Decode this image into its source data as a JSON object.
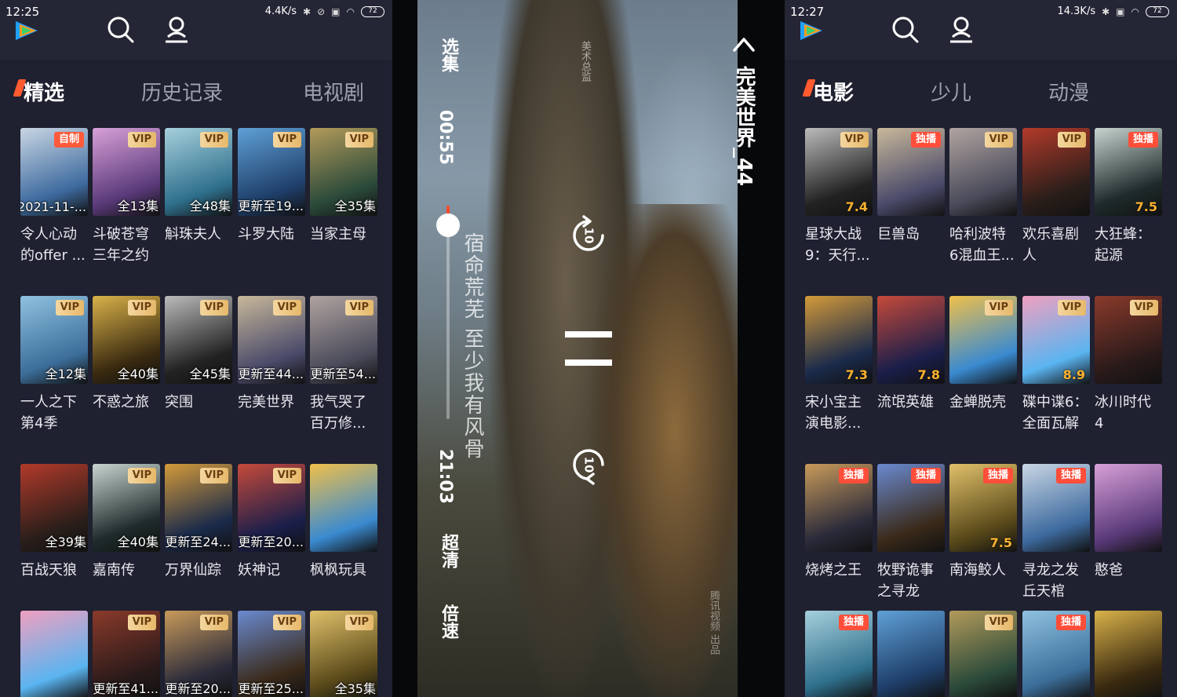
{
  "left": {
    "time": "12:25",
    "speed": "4.4K/s",
    "battery": "72",
    "tabs": [
      "精选",
      "历史记录",
      "电视剧"
    ],
    "cards": [
      {
        "title": "令人心动\n的offer ...",
        "badge": "自制",
        "badge_type": "zizhi",
        "ep": "2021-11-..."
      },
      {
        "title": "斗破苍穹\n三年之约",
        "badge": "VIP",
        "badge_type": "vip",
        "ep": "全13集"
      },
      {
        "title": "斛珠夫人",
        "badge": "VIP",
        "badge_type": "vip",
        "ep": "全48集"
      },
      {
        "title": "斗罗大陆",
        "badge": "VIP",
        "badge_type": "vip",
        "ep": "更新至19..."
      },
      {
        "title": "当家主母",
        "badge": "VIP",
        "badge_type": "vip",
        "ep": "全35集"
      },
      {
        "title": "一人之下\n第4季",
        "badge": "VIP",
        "badge_type": "vip",
        "ep": "全12集"
      },
      {
        "title": "不惑之旅",
        "badge": "VIP",
        "badge_type": "vip",
        "ep": "全40集"
      },
      {
        "title": "突围",
        "badge": "VIP",
        "badge_type": "vip",
        "ep": "全45集"
      },
      {
        "title": "完美世界",
        "badge": "VIP",
        "badge_type": "vip",
        "ep": "更新至44..."
      },
      {
        "title": "我气哭了\n百万修...",
        "badge": "VIP",
        "badge_type": "vip",
        "ep": "更新至54..."
      },
      {
        "title": "百战天狼",
        "badge": "",
        "badge_type": "",
        "ep": "全39集"
      },
      {
        "title": "嘉南传",
        "badge": "VIP",
        "badge_type": "vip",
        "ep": "全40集"
      },
      {
        "title": "万界仙踪",
        "badge": "VIP",
        "badge_type": "vip",
        "ep": "更新至24..."
      },
      {
        "title": "妖神记",
        "badge": "VIP",
        "badge_type": "vip",
        "ep": "更新至20..."
      },
      {
        "title": "枫枫玩具",
        "badge": "",
        "badge_type": "",
        "ep": ""
      },
      {
        "title": "",
        "badge": "",
        "badge_type": "",
        "ep": ""
      },
      {
        "title": "",
        "badge": "VIP",
        "badge_type": "vip",
        "ep": "更新至41..."
      },
      {
        "title": "",
        "badge": "VIP",
        "badge_type": "vip",
        "ep": "更新至20..."
      },
      {
        "title": "",
        "badge": "VIP",
        "badge_type": "vip",
        "ep": "更新至25..."
      },
      {
        "title": "",
        "badge": "VIP",
        "badge_type": "vip",
        "ep": "全35集"
      }
    ]
  },
  "player": {
    "select_episode": "选集",
    "current_time": "00:55",
    "total_time": "21:03",
    "quality": "超清",
    "speed": "倍速",
    "title": "完美世界_44",
    "subtitle": "宿命荒芜 至少我有风骨",
    "credit": "美术总监",
    "watermark": "腾讯视频 出品",
    "skip_seconds": "10",
    "progress": 0.04
  },
  "right": {
    "time": "12:27",
    "speed": "14.3K/s",
    "battery": "72",
    "tabs": [
      "电影",
      "少儿",
      "动漫"
    ],
    "cards": [
      {
        "title": "星球大战\n9：天行...",
        "badge": "VIP",
        "badge_type": "vip",
        "score": "7.4"
      },
      {
        "title": "巨兽岛",
        "badge": "独播",
        "badge_type": "dubo",
        "score": ""
      },
      {
        "title": "哈利波特\n6混血王...",
        "badge": "VIP",
        "badge_type": "vip",
        "score": ""
      },
      {
        "title": "欢乐喜剧\n人",
        "badge": "VIP",
        "badge_type": "vip",
        "score": ""
      },
      {
        "title": "大狂蜂：\n起源",
        "badge": "独播",
        "badge_type": "dubo",
        "score": "7.5"
      },
      {
        "title": "宋小宝主\n演电影...",
        "badge": "",
        "badge_type": "",
        "score": "7.3"
      },
      {
        "title": "流氓英雄",
        "badge": "",
        "badge_type": "",
        "score": "7.8"
      },
      {
        "title": "金蝉脱壳",
        "badge": "VIP",
        "badge_type": "vip",
        "score": ""
      },
      {
        "title": "碟中谍6：\n全面瓦解",
        "badge": "VIP",
        "badge_type": "vip",
        "score": "8.9"
      },
      {
        "title": "冰川时代\n4",
        "badge": "VIP",
        "badge_type": "vip",
        "score": ""
      },
      {
        "title": "烧烤之王",
        "badge": "独播",
        "badge_type": "dubo",
        "score": ""
      },
      {
        "title": "牧野诡事\n之寻龙",
        "badge": "独播",
        "badge_type": "dubo",
        "score": ""
      },
      {
        "title": "南海鲛人",
        "badge": "独播",
        "badge_type": "dubo",
        "score": "7.5"
      },
      {
        "title": "寻龙之发\n丘天棺",
        "badge": "独播",
        "badge_type": "dubo",
        "score": ""
      },
      {
        "title": "憨爸",
        "badge": "",
        "badge_type": "",
        "score": ""
      },
      {
        "title": "",
        "badge": "独播",
        "badge_type": "dubo",
        "score": ""
      },
      {
        "title": "",
        "badge": "",
        "badge_type": "",
        "score": ""
      },
      {
        "title": "",
        "badge": "VIP",
        "badge_type": "vip",
        "score": ""
      },
      {
        "title": "",
        "badge": "独播",
        "badge_type": "dubo",
        "score": ""
      },
      {
        "title": "",
        "badge": "",
        "badge_type": "",
        "score": ""
      }
    ]
  },
  "colors": {
    "background": "#1f2030",
    "topbar": "#242636",
    "accent": "#ff5a30",
    "vip_gold": "#e6b86a",
    "exclusive_red": "#ff4e3a"
  }
}
